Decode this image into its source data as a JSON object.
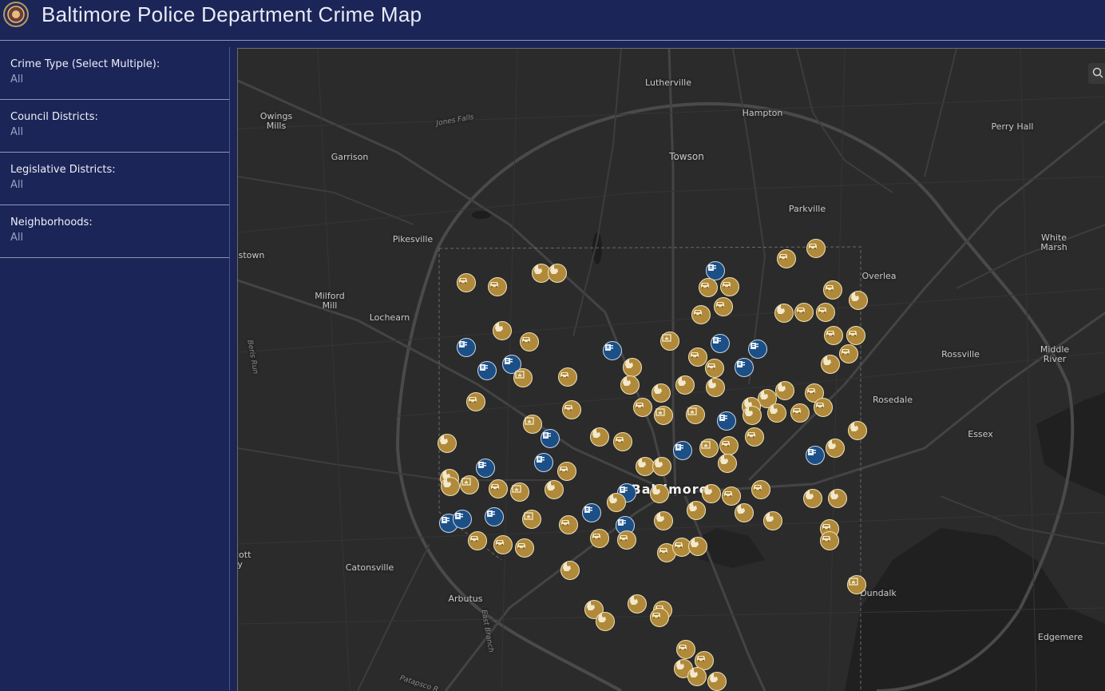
{
  "header": {
    "title": "Baltimore Police Department Crime Map",
    "logo_icon": "police-seal-icon"
  },
  "colors": {
    "header_bg": "#1c2557",
    "map_bg": "#2b2b2b",
    "marker_gold": "#b08a3a",
    "marker_blue": "#1c4f86"
  },
  "filters": [
    {
      "label": "Crime Type (Select Multiple):",
      "value": "All"
    },
    {
      "label": "Council Districts:",
      "value": "All"
    },
    {
      "label": "Legislative Districts:",
      "value": "All"
    },
    {
      "label": "Neighborhoods:",
      "value": "All"
    }
  ],
  "map": {
    "search_icon": "search-icon",
    "places": [
      {
        "text": "Lutherville"
      },
      {
        "text": "Hampton"
      },
      {
        "text": "Owings Mills"
      },
      {
        "text": "Jones Falls"
      },
      {
        "text": "Perry Hall"
      },
      {
        "text": "Garrison"
      },
      {
        "text": "Towson"
      },
      {
        "text": "Parkville"
      },
      {
        "text": "Pikesville"
      },
      {
        "text": "White Marsh"
      },
      {
        "text": "stown"
      },
      {
        "text": "Overlea"
      },
      {
        "text": "Milford Mill"
      },
      {
        "text": "Lochearn"
      },
      {
        "text": "Rossville"
      },
      {
        "text": "Middle River"
      },
      {
        "text": "Rosedale"
      },
      {
        "text": "Essex"
      },
      {
        "text": "Baltimore"
      },
      {
        "text": "Catonsville"
      },
      {
        "text": "Arbutus"
      },
      {
        "text": "Dundalk"
      },
      {
        "text": "Edgemere"
      },
      {
        "text": "Patapsco R."
      },
      {
        "text": "East Branch"
      },
      {
        "text": "Beris Run"
      },
      {
        "text": "cott ty"
      }
    ],
    "marker_types": {
      "car": "car-icon",
      "hand": "robbery-hand-icon",
      "box": "burglary-box-icon",
      "gun": "shooting-icon"
    }
  }
}
